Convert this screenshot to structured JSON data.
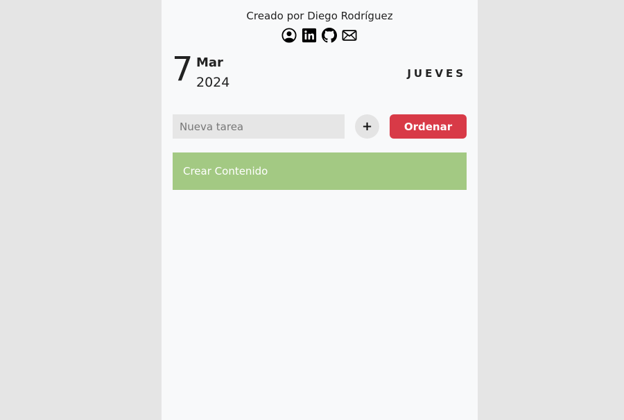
{
  "header": {
    "credit_text": "Creado por Diego Rodríguez",
    "social_icons": [
      "user-circle-icon",
      "linkedin-icon",
      "github-icon",
      "mail-icon"
    ]
  },
  "date": {
    "day": "7",
    "month": "Mar",
    "year": "2024",
    "weekday": "JUEVES"
  },
  "task_form": {
    "input_placeholder": "Nueva tarea",
    "input_value": "",
    "add_label": "+",
    "order_label": "Ordenar"
  },
  "tasks": [
    {
      "text": "Crear Contenido",
      "color": "#a3c983"
    }
  ],
  "colors": {
    "page_background": "#e5e5e5",
    "app_background": "#f8f9fa",
    "order_button": "#d83a47",
    "task_item": "#a3c983"
  }
}
